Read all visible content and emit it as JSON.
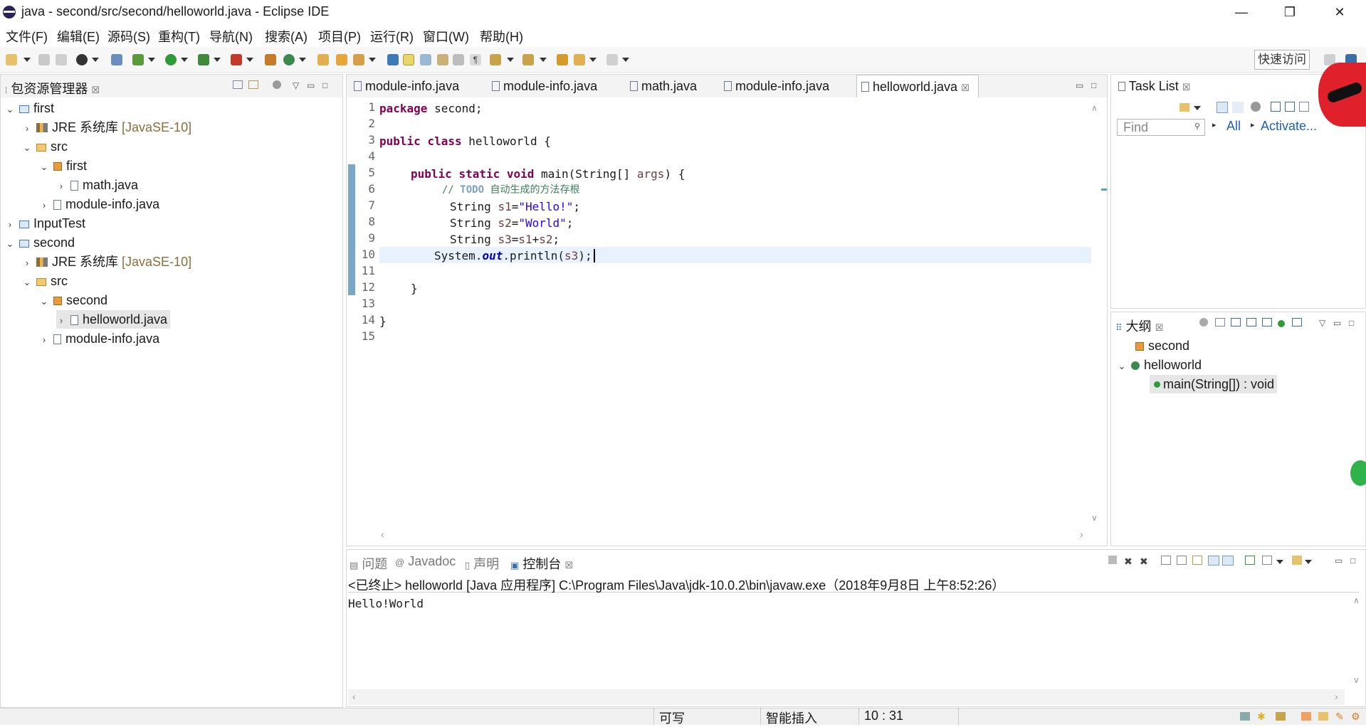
{
  "window": {
    "title": "java - second/src/second/helloworld.java - Eclipse IDE"
  },
  "menu": [
    "文件(F)",
    "编辑(E)",
    "源码(S)",
    "重构(T)",
    "导航(N)",
    "搜索(A)",
    "项目(P)",
    "运行(R)",
    "窗口(W)",
    "帮助(H)"
  ],
  "toolbar": {
    "quick_access": "快速访问"
  },
  "package_explorer": {
    "title": "包资源管理器",
    "items": [
      {
        "label": "first"
      },
      {
        "label": "JRE 系统库",
        "decoration": "[JavaSE-10]"
      },
      {
        "label": "src"
      },
      {
        "label": "first"
      },
      {
        "label": "math.java"
      },
      {
        "label": "module-info.java"
      },
      {
        "label": "InputTest"
      },
      {
        "label": "second"
      },
      {
        "label": "JRE 系统库",
        "decoration": "[JavaSE-10]"
      },
      {
        "label": "src"
      },
      {
        "label": "second"
      },
      {
        "label": "helloworld.java"
      },
      {
        "label": "module-info.java"
      }
    ]
  },
  "editor": {
    "tabs": [
      "module-info.java",
      "module-info.java",
      "math.java",
      "module-info.java",
      "helloworld.java"
    ],
    "active_tab": 4,
    "line_numbers": [
      "1",
      "2",
      "3",
      "4",
      "5",
      "6",
      "7",
      "8",
      "9",
      "10",
      "11",
      "12",
      "13",
      "14",
      "15"
    ],
    "code": {
      "l1_kw": "package",
      "l1_rest": " second;",
      "l3_kw1": "public",
      "l3_kw2": "class",
      "l3_rest": " helloworld {",
      "l5_kw1": "public",
      "l5_kw2": "static",
      "l5_kw3": "void",
      "l5_mid": " main(String[] ",
      "l5_arg": "args",
      "l5_end": ") {",
      "l6_cmt": "// ",
      "l6_todo": "TODO",
      "l6_text": " 自动生成的方法存根",
      "l7_type": "String ",
      "l7_var": "s1",
      "l7_eq": "=",
      "l7_str": "\"Hello!\"",
      "l7_end": ";",
      "l8_type": "String ",
      "l8_var": "s2",
      "l8_eq": "=",
      "l8_str": "\"World\"",
      "l8_end": ";",
      "l9_type": "String ",
      "l9_var": "s3",
      "l9_eq": "=",
      "l9_a": "s1",
      "l9_plus": "+",
      "l9_b": "s2",
      "l9_end": ";",
      "l10_a": "System.",
      "l10_field": "out",
      "l10_b": ".println(",
      "l10_var": "s3",
      "l10_end": ");",
      "l12": "}",
      "l14": "}"
    }
  },
  "task_list": {
    "title": "Task List",
    "find_placeholder": "Find",
    "all_label": "All",
    "activate_label": "Activate..."
  },
  "outline": {
    "title": "大纲",
    "items": [
      "second",
      "helloworld",
      "main(String[]) : void"
    ]
  },
  "bottom_tabs": [
    "问题",
    "Javadoc",
    "声明",
    "控制台"
  ],
  "console": {
    "header": "<已终止> helloworld [Java 应用程序] C:\\Program Files\\Java\\jdk-10.0.2\\bin\\javaw.exe（2018年9月8日 上午8:52:26）",
    "output": "Hello!World"
  },
  "status": {
    "writable": "可写",
    "insert_mode": "智能插入",
    "position": "10 : 31"
  }
}
